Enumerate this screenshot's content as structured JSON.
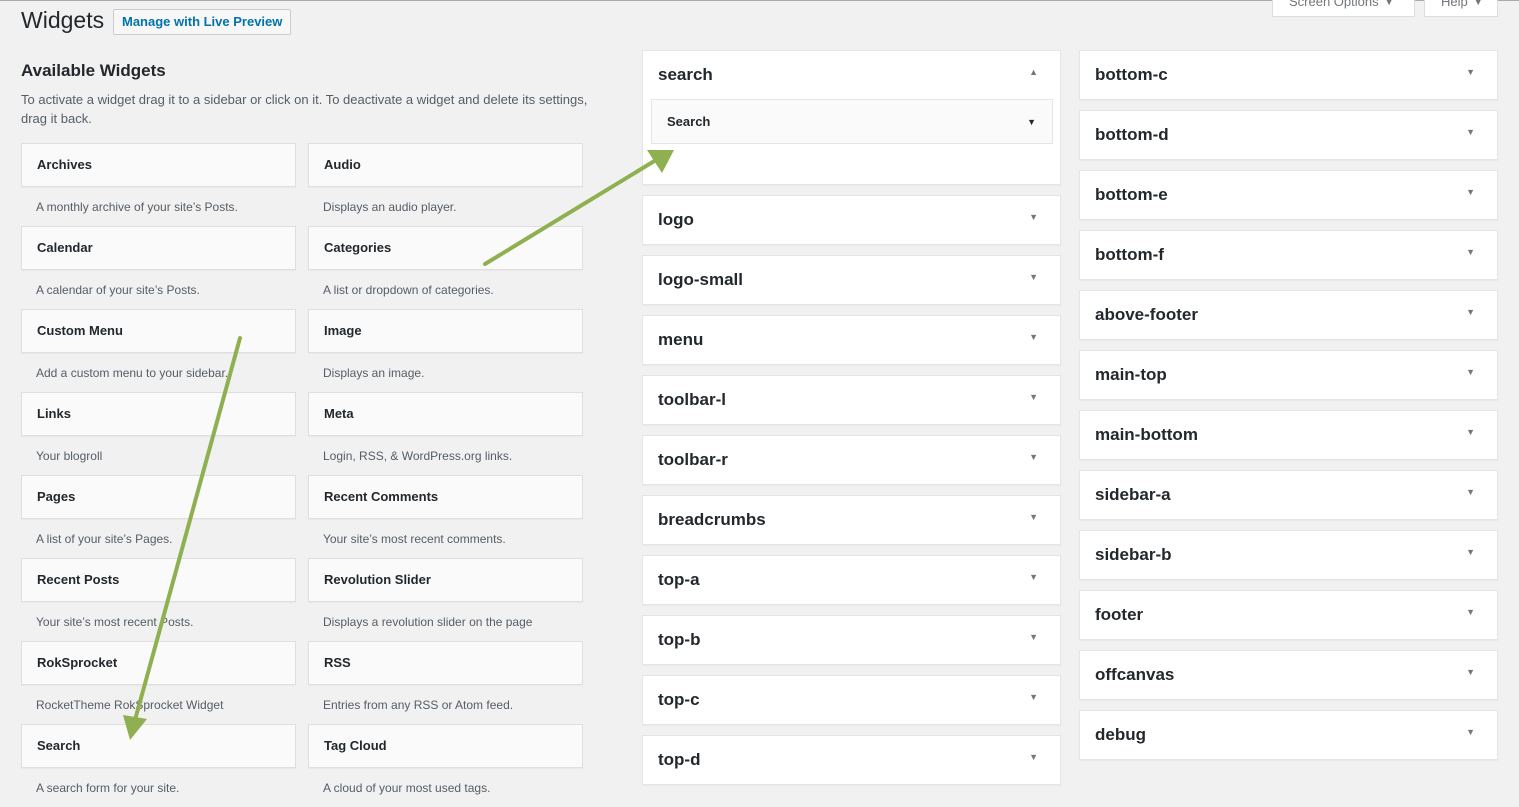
{
  "header": {
    "title": "Widgets",
    "live_preview_label": "Manage with Live Preview",
    "screen_options_label": "Screen Options",
    "help_label": "Help"
  },
  "available": {
    "title": "Available Widgets",
    "description": "To activate a widget drag it to a sidebar or click on it. To deactivate a widget and delete its settings, drag it back."
  },
  "widgets": [
    {
      "name": "Archives",
      "desc": "A monthly archive of your site’s Posts."
    },
    {
      "name": "Audio",
      "desc": "Displays an audio player."
    },
    {
      "name": "Calendar",
      "desc": "A calendar of your site’s Posts."
    },
    {
      "name": "Categories",
      "desc": "A list or dropdown of categories."
    },
    {
      "name": "Custom Menu",
      "desc": "Add a custom menu to your sidebar."
    },
    {
      "name": "Image",
      "desc": "Displays an image."
    },
    {
      "name": "Links",
      "desc": "Your blogroll"
    },
    {
      "name": "Meta",
      "desc": "Login, RSS, & WordPress.org links."
    },
    {
      "name": "Pages",
      "desc": "A list of your site’s Pages."
    },
    {
      "name": "Recent Comments",
      "desc": "Your site’s most recent comments."
    },
    {
      "name": "Recent Posts",
      "desc": "Your site’s most recent Posts."
    },
    {
      "name": "Revolution Slider",
      "desc": "Displays a revolution slider on the page"
    },
    {
      "name": "RokSprocket",
      "desc": "RocketTheme RokSprocket Widget"
    },
    {
      "name": "RSS",
      "desc": "Entries from any RSS or Atom feed."
    },
    {
      "name": "Search",
      "desc": "A search form for your site."
    },
    {
      "name": "Tag Cloud",
      "desc": "A cloud of your most used tags."
    }
  ],
  "sidebars_col1": {
    "open": {
      "name": "search",
      "toggle": "▲",
      "widget": "Search",
      "widget_toggle": "▼"
    },
    "items": [
      "logo",
      "logo-small",
      "menu",
      "toolbar-l",
      "toolbar-r",
      "breadcrumbs",
      "top-a",
      "top-b",
      "top-c",
      "top-d"
    ]
  },
  "sidebars_col2": {
    "items": [
      "bottom-c",
      "bottom-d",
      "bottom-e",
      "bottom-f",
      "above-footer",
      "main-top",
      "main-bottom",
      "sidebar-a",
      "sidebar-b",
      "footer",
      "offcanvas",
      "debug"
    ]
  },
  "toggle_glyph": "▼",
  "colors": {
    "arrow": "#8fb050",
    "link": "#0073aa"
  }
}
